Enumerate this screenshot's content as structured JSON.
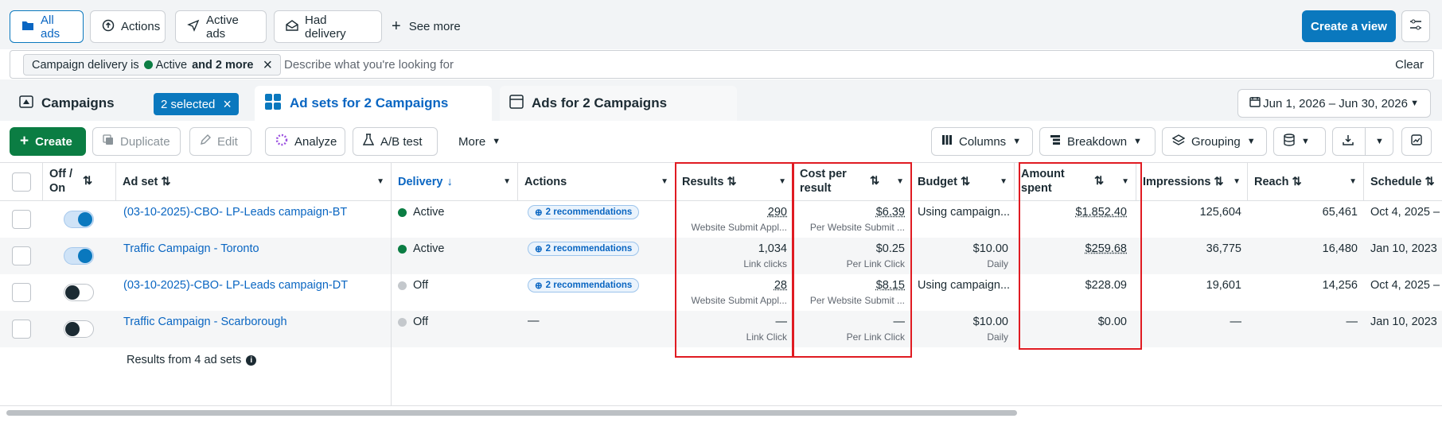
{
  "views": {
    "all_ads": "All ads",
    "actions": "Actions",
    "active_ads": "Active ads",
    "had_delivery": "Had delivery",
    "see_more": "See more",
    "create_view": "Create a view"
  },
  "filter": {
    "chip_prefix": "Campaign delivery is",
    "chip_status": "Active",
    "chip_suffix": "and 2 more",
    "placeholder": "Describe what you're looking for",
    "clear": "Clear"
  },
  "tabs": {
    "campaigns": "Campaigns",
    "selected_badge": "2 selected",
    "adsets": "Ad sets for 2 Campaigns",
    "ads": "Ads for 2 Campaigns",
    "date_range": "Jun 1, 2026 – Jun 30, 2026"
  },
  "toolbar": {
    "create": "Create",
    "duplicate": "Duplicate",
    "edit": "Edit",
    "analyze": "Analyze",
    "ab_test": "A/B test",
    "more": "More",
    "columns": "Columns",
    "breakdown": "Breakdown",
    "grouping": "Grouping"
  },
  "columns": {
    "off_on": "Off / On",
    "ad_set": "Ad set",
    "delivery": "Delivery",
    "actions": "Actions",
    "results": "Results",
    "cost_per_result": "Cost per result",
    "budget": "Budget",
    "amount_spent": "Amount spent",
    "impressions": "Impressions",
    "reach": "Reach",
    "schedule": "Schedule"
  },
  "rows": [
    {
      "on": true,
      "name": "(03-10-2025)-CBO- LP-Leads campaign-BT",
      "delivery": "Active",
      "delivery_color": "#0b7d43",
      "actions": "2 recommendations",
      "results": "290",
      "results_sub": "Website Submit Appl...",
      "cpr": "$6.39",
      "cpr_sub": "Per Website Submit ...",
      "budget": "Using campaign...",
      "budget_sub": "",
      "spent": "$1,852.40",
      "impressions": "125,604",
      "reach": "65,461",
      "schedule": "Oct 4, 2025 –"
    },
    {
      "on": true,
      "name": "Traffic Campaign - Toronto",
      "delivery": "Active",
      "delivery_color": "#0b7d43",
      "actions": "2 recommendations",
      "results": "1,034",
      "results_sub": "Link clicks",
      "cpr": "$0.25",
      "cpr_sub": "Per Link Click",
      "budget": "$10.00",
      "budget_sub": "Daily",
      "spent": "$259.68",
      "impressions": "36,775",
      "reach": "16,480",
      "schedule": "Jan 10, 2023"
    },
    {
      "on": false,
      "name": "(03-10-2025)-CBO- LP-Leads campaign-DT",
      "delivery": "Off",
      "delivery_color": "#c4c8cc",
      "actions": "2 recommendations",
      "results": "28",
      "results_sub": "Website Submit Appl...",
      "cpr": "$8.15",
      "cpr_sub": "Per Website Submit ...",
      "budget": "Using campaign...",
      "budget_sub": "",
      "spent": "$228.09",
      "impressions": "19,601",
      "reach": "14,256",
      "schedule": "Oct 4, 2025 –"
    },
    {
      "on": false,
      "name": "Traffic Campaign - Scarborough",
      "delivery": "Off",
      "delivery_color": "#c4c8cc",
      "actions": "—",
      "results": "—",
      "results_sub": "Link Click",
      "cpr": "—",
      "cpr_sub": "Per Link Click",
      "budget": "$10.00",
      "budget_sub": "Daily",
      "spent": "$0.00",
      "impressions": "—",
      "reach": "—",
      "schedule": "Jan 10, 2023"
    }
  ],
  "summary": "Results from 4 ad sets",
  "colors": {
    "accent": "#0a78be",
    "create": "#0b7d43",
    "highlight": "#e01b22"
  }
}
